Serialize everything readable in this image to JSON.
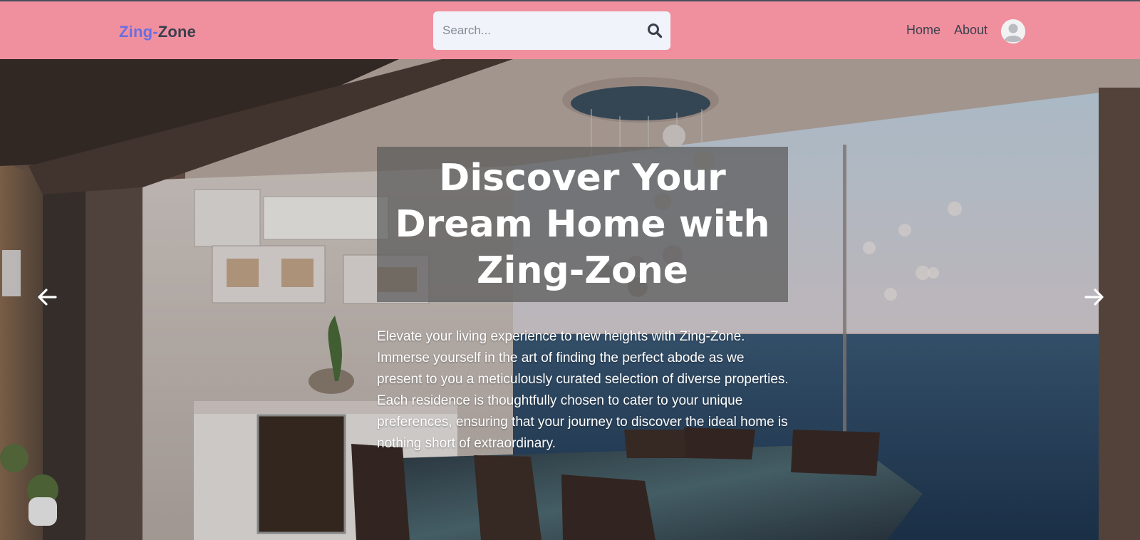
{
  "navbar": {
    "brand_part1": "Zing-",
    "brand_part2": "Zone",
    "search_placeholder": "Search...",
    "search_icon": "search-icon",
    "links": [
      {
        "label": "Home"
      },
      {
        "label": "About"
      }
    ],
    "avatar_icon": "user-avatar-icon"
  },
  "hero": {
    "title": "Discover Your Dream Home with Zing-Zone",
    "description": "Elevate your living experience to new heights with Zing-Zone. Immerse yourself in the art of finding the perfect abode as we present to you a meticulously curated selection of diverse properties. Each residence is thoughtfully chosen to cater to your unique preferences, ensuring that your journey to discover the ideal home is nothing short of extraordinary.",
    "prev_icon": "arrow-left-icon",
    "next_icon": "arrow-right-icon"
  },
  "colors": {
    "navbar_bg": "#f0909f",
    "brand_accent": "#6a6fe0",
    "brand_dark": "#3a3f4d",
    "search_bg": "#f0f4fa"
  }
}
